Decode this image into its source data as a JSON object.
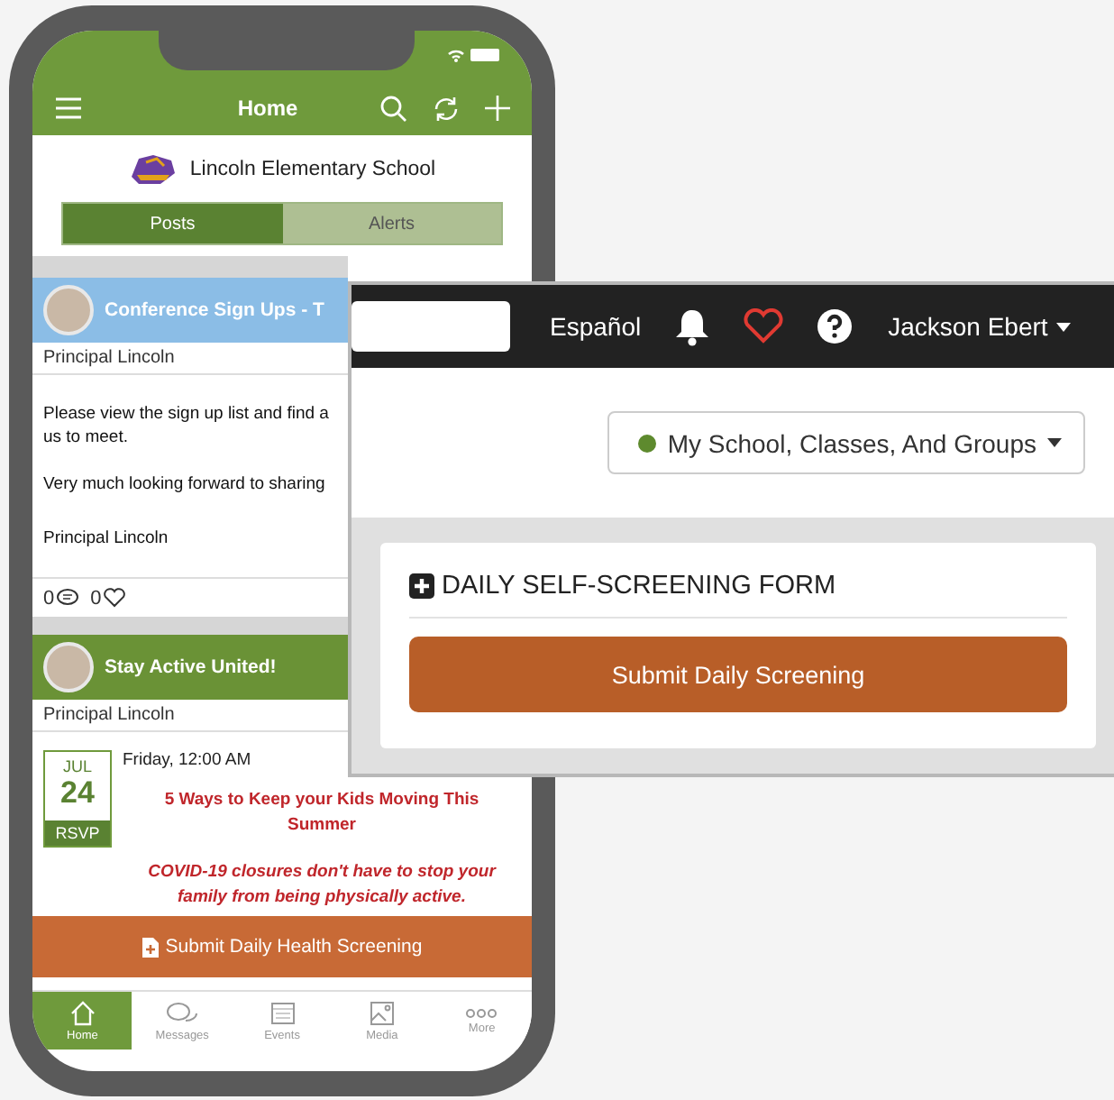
{
  "phone": {
    "header": {
      "title": "Home"
    },
    "school": {
      "name": "Lincoln Elementary School"
    },
    "tabs": [
      {
        "label": "Posts",
        "selected": true
      },
      {
        "label": "Alerts",
        "selected": false
      }
    ],
    "posts": [
      {
        "kind": "text",
        "color": "#8bbde6",
        "title": "Conference Sign Ups - T",
        "author": "Principal Lincoln",
        "lines": [
          "Please view the sign up list and find a",
          "us to meet.",
          "Very much looking forward to sharing",
          "Principal Lincoln"
        ],
        "comments": "0",
        "likes": "0"
      },
      {
        "kind": "event",
        "color": "#6a9236",
        "title": "Stay Active United!",
        "author": "Principal Lincoln",
        "month": "JUL",
        "day": "24",
        "rsvp": "RSVP",
        "when": "Friday, 12:00 AM",
        "headline": "5 Ways to Keep your Kids Moving This Summer",
        "text": "COVID-19 closures don't have to stop your family from being physically active."
      }
    ],
    "screening_button": "Submit Daily Health Screening",
    "nav": [
      {
        "label": "Home",
        "selected": true
      },
      {
        "label": "Messages",
        "selected": false
      },
      {
        "label": "Events",
        "selected": false
      },
      {
        "label": "Media",
        "selected": false
      },
      {
        "label": "More",
        "selected": false
      }
    ]
  },
  "web": {
    "top_bar": {
      "language": "Español",
      "user": "Jackson Ebert"
    },
    "filter": {
      "label": "My School, Classes, And Groups",
      "color": "#5e8a2e"
    },
    "form": {
      "title": "DAILY SELF-SCREENING FORM",
      "button": "Submit Daily Screening"
    }
  }
}
